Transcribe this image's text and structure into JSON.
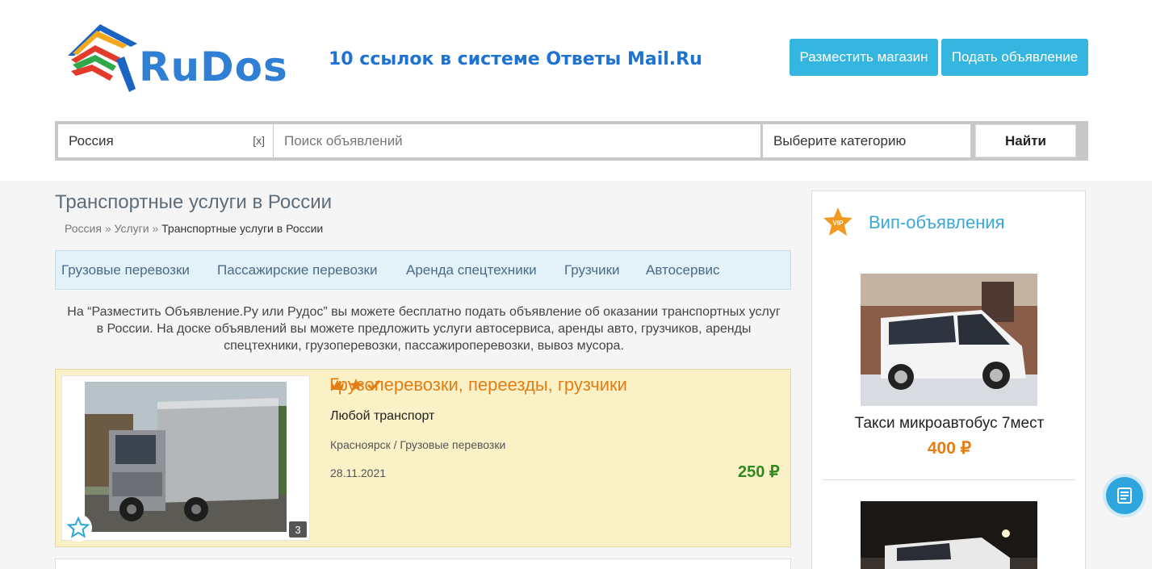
{
  "header": {
    "logo_text": "RuDos",
    "promo_text": "10 ссылок в системе Ответы Mail.Ru",
    "btn_shop": "Разместить магазин",
    "btn_ad": "Подать объявление"
  },
  "search": {
    "region": "Россия",
    "clear": "[x]",
    "placeholder": "Поиск объявлений",
    "category": "Выберите категорию",
    "submit": "Найти"
  },
  "page": {
    "title": "Транспортные услуги в России",
    "breadcrumb": [
      "Россия",
      "Услуги",
      "Транспортные услуги в России"
    ],
    "breadcrumb_sep": "»",
    "categories": [
      "Грузовые перевозки",
      "Пассажирские перевозки",
      "Аренда спецтехники",
      "Грузчики",
      "Автосервис"
    ],
    "intro": "На “Разместить Объявление.Ру или Рудос” вы можете бесплатно подать объявление об оказании транспортных услуг в России. На доске объявлений вы можете предложить услуги автосервиса, аренды авто, грузчиков, аренды спецтехники, грузоперевозки, пассажироперевозки, вывоз мусора."
  },
  "listing": {
    "title": "Грузоперевозки, переезды, грузчики",
    "subtitle": "Любой транспорт",
    "location": "Красноярск / Грузовые перевозки",
    "date": "28.11.2021",
    "price": "250 ₽",
    "photo_count": "3",
    "icons": [
      "crown-icon",
      "star-icon",
      "check-icon"
    ]
  },
  "sidebar": {
    "title": "Вип-объявления",
    "badge": "VIP",
    "item1_name": "Такси микроавтобус 7мест",
    "item1_price": "400 ₽"
  },
  "colors": {
    "accent_blue": "#35b6e0",
    "title_orange": "#e47d14",
    "price_green": "#2f8a1e",
    "vip_bg": "#fbf1c7"
  }
}
